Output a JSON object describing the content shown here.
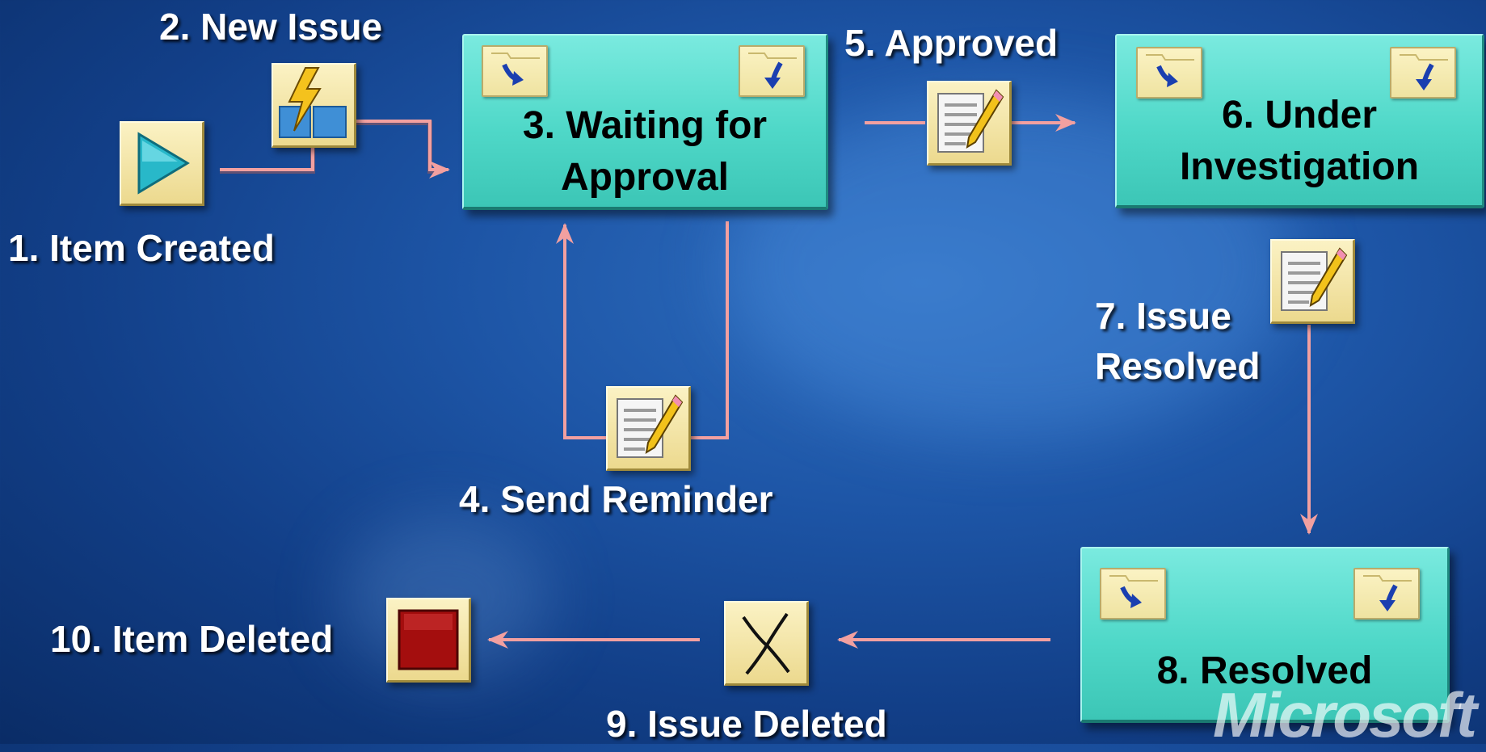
{
  "steps": {
    "s1": "1. Item Created",
    "s2": "2. New Issue",
    "s3": "3. Waiting for Approval",
    "s4": "4. Send Reminder",
    "s5": "5. Approved",
    "s6": "6. Under Investigation",
    "s7": "7. Issue Resolved",
    "s8": "8. Resolved",
    "s9": "9. Issue Deleted",
    "s10": "10. Item Deleted"
  },
  "logo_text": "Microsoft",
  "icons": {
    "start": "play-icon",
    "event": "lightning-icon",
    "activity": "pencil-document-icon",
    "delete": "x-icon",
    "stop": "stop-icon",
    "folder": "folder-arrow-icon"
  },
  "colors": {
    "background": "#1d55a6",
    "state_fill": "#4fd8c8",
    "tile_fill": "#f3e3a4",
    "connector": "#f2a0a0",
    "label_text": "#ffffff"
  }
}
